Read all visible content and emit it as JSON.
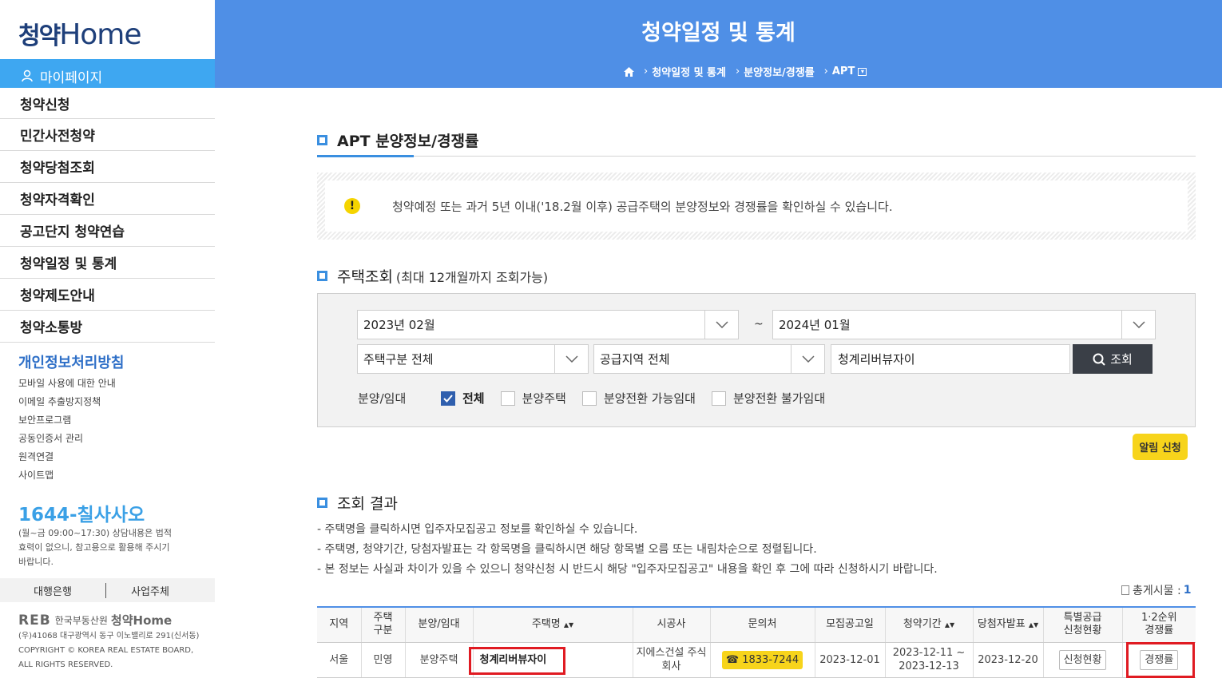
{
  "sidebar": {
    "logo_part1": "청약",
    "logo_part2": "Home",
    "mypage": "마이페이지",
    "menu": [
      "청약신청",
      "민간사전청약",
      "청약당첨조회",
      "청약자격확인",
      "공고단지 청약연습",
      "청약일정 및 통계",
      "청약제도안내",
      "청약소통방"
    ],
    "privacy": "개인정보처리방침",
    "links": [
      "모바일 사용에 대한 안내",
      "이메일 추출방지정책",
      "보안프로그램",
      "공동인증서 관리",
      "원격연결",
      "사이트맵"
    ],
    "phone": "1644-칠사사오",
    "phone_note": "(월~금 09:00~17:30) 상담내용은 법적효력이 없으니, 참고용으로 활용해 주시기 바랍니다.",
    "bank": "대행은행",
    "operator": "사업주체",
    "footer_org": "한국부동산원",
    "footer_reb": "REB",
    "footer_home": "청약Home",
    "footer_address": "(우)41068 대구광역시 동구 이노밸리로 291(신서동)",
    "footer_copy": "COPYRIGHT © KOREA REAL ESTATE BOARD, ALL RIGHTS RESERVED."
  },
  "header": {
    "title": "청약일정 및 통계",
    "breadcrumb": [
      "청약일정 및 통계",
      "분양정보/경쟁률",
      "APT"
    ]
  },
  "section1": {
    "title": "APT 분양정보/경쟁률",
    "notice": "청약예정 또는 과거 5년 이내('18.2월 이후) 공급주택의 분양정보와 경쟁률을 확인하실 수 있습니다."
  },
  "search": {
    "title": "주택조회",
    "subtitle": "(최대 12개월까지 조회가능)",
    "start_month": "2023년 02월",
    "tilde": "~",
    "end_month": "2024년 01월",
    "house_type": "주택구분 전체",
    "region": "공급지역 전체",
    "keyword": "청계리버뷰자이",
    "search_button": "조회",
    "filter_label": "분양/임대",
    "filters": [
      "전체",
      "분양주택",
      "분양전환 가능임대",
      "분양전환 불가임대"
    ],
    "alarm_button": "알림 신청"
  },
  "results": {
    "title": "조회 결과",
    "notes": [
      "-  주택명을 클릭하시면 입주자모집공고 정보를 확인하실 수 있습니다.",
      "-  주택명, 청약기간, 당첨자발표는 각 항목명을 클릭하시면 해당 항목별 오름 또는 내림차순으로 정렬됩니다.",
      "-  본 정보는 사실과 차이가 있을 수 있으니 청약신청 시 반드시 해당 \"입주자모집공고\" 내용을 확인 후 그에 따라 신청하시기 바랍니다."
    ],
    "total_label": "총게시물 :",
    "total_count": "1",
    "headers": [
      "지역",
      "주택\n구분",
      "분양/임대",
      "주택명",
      "시공사",
      "문의처",
      "모집공고일",
      "청약기간",
      "당첨자발표",
      "특별공급\n신청현황",
      "1·2순위\n경쟁률"
    ],
    "row": {
      "region": "서울",
      "type": "민영",
      "sale": "분양주택",
      "name": "청계리버뷰자이",
      "builder": "지에스건설 주식회사",
      "phone": "☎ 1833-7244",
      "notice_date": "2023-12-01",
      "period": "2023-12-11 ~ 2023-12-13",
      "winner_date": "2023-12-20",
      "special_btn": "신청현황",
      "rate_btn": "경쟁률"
    }
  }
}
